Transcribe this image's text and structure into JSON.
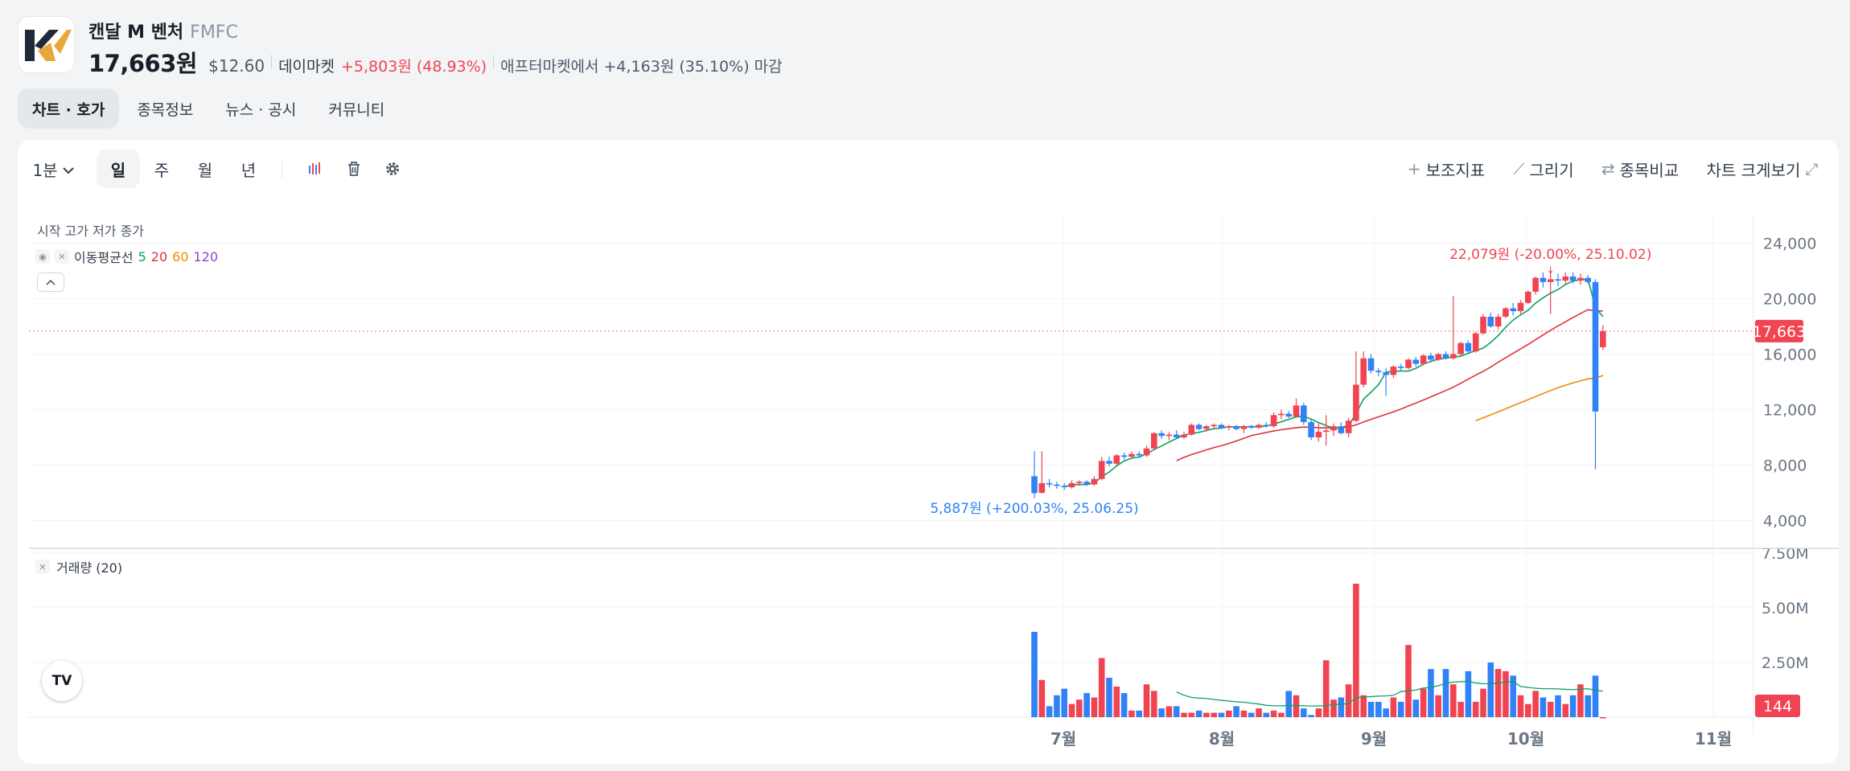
{
  "stock": {
    "name": "캔달 M 벤처",
    "ticker": "FMFC",
    "price": "17,663원",
    "usd": "$12.60",
    "market_label": "데이마켓",
    "change": "+5,803원 (48.93%)",
    "after_market": "애프터마켓에서 +4,163원 (35.10%) 마감"
  },
  "tabs": [
    {
      "label": "차트 · 호가",
      "active": true
    },
    {
      "label": "종목정보"
    },
    {
      "label": "뉴스 · 공시"
    },
    {
      "label": "커뮤니티"
    }
  ],
  "toolbar": {
    "interval": "1분",
    "periods": [
      "일",
      "주",
      "월",
      "년"
    ],
    "active_period": "일",
    "indicator_label": "보조지표",
    "draw_label": "그리기",
    "compare_label": "종목비교",
    "expand_label": "차트 크게보기",
    "icons": [
      "candle-type-icon",
      "trash-icon",
      "gear-icon"
    ]
  },
  "legend": {
    "ohlc_label": "시작 고가 저가 종가",
    "ma_label": "이동평균선",
    "ma_periods": [
      {
        "label": "5",
        "color": "#0ea163"
      },
      {
        "label": "20",
        "color": "#e0303d"
      },
      {
        "label": "60",
        "color": "#f08c00"
      },
      {
        "label": "120",
        "color": "#8e44c8"
      }
    ],
    "volume_label": "거래량 (20)"
  },
  "chart_data": {
    "type": "candlestick",
    "x_axis_labels": [
      "7월",
      "8월",
      "9월",
      "10월",
      "11월"
    ],
    "y_ticks": [
      "24,000",
      "20,000",
      "16,000",
      "12,000",
      "8,000",
      "4,000"
    ],
    "volume_ticks": [
      "7.50M",
      "5.00M",
      "2.50M"
    ],
    "current_price_label": "17,663",
    "current_volume_label": "144",
    "high_annotation": "22,079원 (-20.00%, 25.10.02)",
    "low_annotation": "5,887원 (+200.03%, 25.06.25)",
    "ylim": [
      2000,
      26000
    ],
    "volume_max": 7500000,
    "up_color": "#f04452",
    "down_color": "#3182f6",
    "candles": [
      {
        "date": "25.06.25",
        "o": 7200,
        "h": 9000,
        "l": 5887,
        "c": 6000,
        "v": 3900000
      },
      {
        "date": "25.06.26",
        "o": 6000,
        "h": 9000,
        "l": 5950,
        "c": 6700,
        "v": 1700000
      },
      {
        "date": "25.06.27",
        "o": 6700,
        "h": 7000,
        "l": 6400,
        "c": 6600,
        "v": 500000
      },
      {
        "date": "25.06.30",
        "o": 6600,
        "h": 6800,
        "l": 6300,
        "c": 6500,
        "v": 1000000
      },
      {
        "date": "25.07.01",
        "o": 6500,
        "h": 6700,
        "l": 6200,
        "c": 6400,
        "v": 1300000
      },
      {
        "date": "25.07.02",
        "o": 6400,
        "h": 6900,
        "l": 6300,
        "c": 6700,
        "v": 600000
      },
      {
        "date": "25.07.03",
        "o": 6700,
        "h": 6900,
        "l": 6500,
        "c": 6800,
        "v": 800000
      },
      {
        "date": "25.07.07",
        "o": 6800,
        "h": 6900,
        "l": 6500,
        "c": 6600,
        "v": 1100000
      },
      {
        "date": "25.07.08",
        "o": 6600,
        "h": 7200,
        "l": 6500,
        "c": 7000,
        "v": 900000
      },
      {
        "date": "25.07.09",
        "o": 7000,
        "h": 8600,
        "l": 6900,
        "c": 8300,
        "v": 2700000
      },
      {
        "date": "25.07.10",
        "o": 8300,
        "h": 8600,
        "l": 7900,
        "c": 8100,
        "v": 1800000
      },
      {
        "date": "25.07.11",
        "o": 8100,
        "h": 8800,
        "l": 7900,
        "c": 8700,
        "v": 1400000
      },
      {
        "date": "25.07.14",
        "o": 8700,
        "h": 8900,
        "l": 8400,
        "c": 8600,
        "v": 1100000
      },
      {
        "date": "25.07.15",
        "o": 8600,
        "h": 9000,
        "l": 8500,
        "c": 8800,
        "v": 300000
      },
      {
        "date": "25.07.16",
        "o": 8800,
        "h": 9000,
        "l": 8500,
        "c": 8700,
        "v": 300000
      },
      {
        "date": "25.07.17",
        "o": 8700,
        "h": 9400,
        "l": 8600,
        "c": 9200,
        "v": 1500000
      },
      {
        "date": "25.07.18",
        "o": 9200,
        "h": 10400,
        "l": 9100,
        "c": 10300,
        "v": 1200000
      },
      {
        "date": "25.07.21",
        "o": 10300,
        "h": 10500,
        "l": 9900,
        "c": 10100,
        "v": 400000
      },
      {
        "date": "25.07.22",
        "o": 10100,
        "h": 10400,
        "l": 9800,
        "c": 10200,
        "v": 500000
      },
      {
        "date": "25.07.23",
        "o": 10200,
        "h": 10500,
        "l": 9900,
        "c": 10000,
        "v": 500000
      },
      {
        "date": "25.07.24",
        "o": 10000,
        "h": 10400,
        "l": 9900,
        "c": 10200,
        "v": 200000
      },
      {
        "date": "25.07.25",
        "o": 10200,
        "h": 11000,
        "l": 10100,
        "c": 10900,
        "v": 200000
      },
      {
        "date": "25.07.28",
        "o": 10900,
        "h": 11000,
        "l": 10500,
        "c": 10600,
        "v": 300000
      },
      {
        "date": "25.07.29",
        "o": 10600,
        "h": 10900,
        "l": 10400,
        "c": 10800,
        "v": 200000
      },
      {
        "date": "25.07.30",
        "o": 10800,
        "h": 11000,
        "l": 10600,
        "c": 10900,
        "v": 200000
      },
      {
        "date": "25.07.31",
        "o": 10900,
        "h": 11000,
        "l": 10600,
        "c": 10700,
        "v": 200000
      },
      {
        "date": "25.08.01",
        "o": 10700,
        "h": 10900,
        "l": 10500,
        "c": 10800,
        "v": 300000
      },
      {
        "date": "25.08.04",
        "o": 10800,
        "h": 10900,
        "l": 10500,
        "c": 10600,
        "v": 500000
      },
      {
        "date": "25.08.05",
        "o": 10600,
        "h": 10900,
        "l": 10300,
        "c": 10800,
        "v": 300000
      },
      {
        "date": "25.08.06",
        "o": 10800,
        "h": 10900,
        "l": 10600,
        "c": 10700,
        "v": 200000
      },
      {
        "date": "25.08.07",
        "o": 10700,
        "h": 11000,
        "l": 10600,
        "c": 10900,
        "v": 400000
      },
      {
        "date": "25.08.08",
        "o": 10900,
        "h": 11100,
        "l": 10700,
        "c": 10800,
        "v": 200000
      },
      {
        "date": "25.08.11",
        "o": 10800,
        "h": 11800,
        "l": 10700,
        "c": 11600,
        "v": 300000
      },
      {
        "date": "25.08.12",
        "o": 11600,
        "h": 12000,
        "l": 11300,
        "c": 11700,
        "v": 200000
      },
      {
        "date": "25.08.13",
        "o": 11700,
        "h": 11900,
        "l": 11400,
        "c": 11500,
        "v": 1200000
      },
      {
        "date": "25.08.14",
        "o": 11500,
        "h": 12800,
        "l": 11400,
        "c": 12300,
        "v": 1000000
      },
      {
        "date": "25.08.15",
        "o": 12300,
        "h": 12500,
        "l": 10900,
        "c": 11100,
        "v": 400000
      },
      {
        "date": "25.08.18",
        "o": 11100,
        "h": 11300,
        "l": 9800,
        "c": 10000,
        "v": 100000
      },
      {
        "date": "25.08.19",
        "o": 10000,
        "h": 11000,
        "l": 9700,
        "c": 10400,
        "v": 400000
      },
      {
        "date": "25.08.20",
        "o": 10400,
        "h": 11600,
        "l": 9400,
        "c": 10500,
        "v": 2600000
      },
      {
        "date": "25.08.21",
        "o": 10500,
        "h": 11000,
        "l": 10100,
        "c": 10800,
        "v": 800000
      },
      {
        "date": "25.08.22",
        "o": 10800,
        "h": 11100,
        "l": 10200,
        "c": 10300,
        "v": 900000
      },
      {
        "date": "25.08.25",
        "o": 10300,
        "h": 11400,
        "l": 10000,
        "c": 11200,
        "v": 1500000
      },
      {
        "date": "25.08.26",
        "o": 11200,
        "h": 16200,
        "l": 11100,
        "c": 13800,
        "v": 6100000
      },
      {
        "date": "25.08.27",
        "o": 13800,
        "h": 16200,
        "l": 13600,
        "c": 15700,
        "v": 1000000
      },
      {
        "date": "25.08.28",
        "o": 15700,
        "h": 16000,
        "l": 14600,
        "c": 14800,
        "v": 700000
      },
      {
        "date": "25.08.29",
        "o": 14800,
        "h": 15000,
        "l": 14400,
        "c": 14700,
        "v": 700000
      },
      {
        "date": "25.09.02",
        "o": 14700,
        "h": 15000,
        "l": 13000,
        "c": 14500,
        "v": 400000
      },
      {
        "date": "25.09.03",
        "o": 14500,
        "h": 15200,
        "l": 14300,
        "c": 15100,
        "v": 900000
      },
      {
        "date": "25.09.04",
        "o": 15100,
        "h": 15300,
        "l": 14800,
        "c": 15000,
        "v": 700000
      },
      {
        "date": "25.09.05",
        "o": 15000,
        "h": 15700,
        "l": 14900,
        "c": 15600,
        "v": 3300000
      },
      {
        "date": "25.09.08",
        "o": 15600,
        "h": 15800,
        "l": 15100,
        "c": 15300,
        "v": 800000
      },
      {
        "date": "25.09.09",
        "o": 15300,
        "h": 16000,
        "l": 15200,
        "c": 15900,
        "v": 1300000
      },
      {
        "date": "25.09.10",
        "o": 15900,
        "h": 16100,
        "l": 15400,
        "c": 15600,
        "v": 2200000
      },
      {
        "date": "25.09.11",
        "o": 15600,
        "h": 16100,
        "l": 15500,
        "c": 16000,
        "v": 1000000
      },
      {
        "date": "25.09.12",
        "o": 16000,
        "h": 16200,
        "l": 15600,
        "c": 15700,
        "v": 2200000
      },
      {
        "date": "25.09.15",
        "o": 15700,
        "h": 20200,
        "l": 15600,
        "c": 16000,
        "v": 1500000
      },
      {
        "date": "25.09.16",
        "o": 16000,
        "h": 16900,
        "l": 15900,
        "c": 16800,
        "v": 700000
      },
      {
        "date": "25.09.17",
        "o": 16800,
        "h": 17000,
        "l": 16000,
        "c": 16200,
        "v": 2100000
      },
      {
        "date": "25.09.18",
        "o": 16200,
        "h": 17600,
        "l": 16100,
        "c": 17500,
        "v": 700000
      },
      {
        "date": "25.09.19",
        "o": 17500,
        "h": 18900,
        "l": 17400,
        "c": 18700,
        "v": 1300000
      },
      {
        "date": "25.09.22",
        "o": 18700,
        "h": 19000,
        "l": 17900,
        "c": 18000,
        "v": 2500000
      },
      {
        "date": "25.09.23",
        "o": 18000,
        "h": 18900,
        "l": 17800,
        "c": 18700,
        "v": 2200000
      },
      {
        "date": "25.09.24",
        "o": 18700,
        "h": 19400,
        "l": 18600,
        "c": 19300,
        "v": 2100000
      },
      {
        "date": "25.09.25",
        "o": 19300,
        "h": 19700,
        "l": 18800,
        "c": 19100,
        "v": 1900000
      },
      {
        "date": "25.09.26",
        "o": 19100,
        "h": 19900,
        "l": 18900,
        "c": 19700,
        "v": 1000000
      },
      {
        "date": "25.09.29",
        "o": 19700,
        "h": 20600,
        "l": 19600,
        "c": 20500,
        "v": 600000
      },
      {
        "date": "25.09.30",
        "o": 20500,
        "h": 21600,
        "l": 20300,
        "c": 21500,
        "v": 1200000
      },
      {
        "date": "25.10.01",
        "o": 21500,
        "h": 21900,
        "l": 20800,
        "c": 21200,
        "v": 900000
      },
      {
        "date": "25.10.02",
        "o": 21200,
        "h": 22079,
        "l": 18900,
        "c": 21400,
        "v": 700000
      },
      {
        "date": "25.10.03",
        "o": 21400,
        "h": 21800,
        "l": 20900,
        "c": 21300,
        "v": 1000000
      },
      {
        "date": "25.10.06",
        "o": 21300,
        "h": 21900,
        "l": 21000,
        "c": 21600,
        "v": 600000
      },
      {
        "date": "25.10.07",
        "o": 21600,
        "h": 21900,
        "l": 21100,
        "c": 21300,
        "v": 1000000
      },
      {
        "date": "25.10.08",
        "o": 21300,
        "h": 21800,
        "l": 21000,
        "c": 21500,
        "v": 1500000
      },
      {
        "date": "25.10.09",
        "o": 21500,
        "h": 21700,
        "l": 21100,
        "c": 21200,
        "v": 1000000
      },
      {
        "date": "25.10.10",
        "o": 21200,
        "h": 21400,
        "l": 7700,
        "c": 11860,
        "v": 1900000
      },
      {
        "date": "25.10.13",
        "o": 16500,
        "h": 18100,
        "l": 16300,
        "c": 17663,
        "v": 144
      }
    ],
    "ma5": [
      null,
      null,
      null,
      null,
      6440,
      6580,
      6600,
      6600,
      6700,
      7160,
      7500,
      7940,
      8300,
      8500,
      8580,
      8800,
      9120,
      9380,
      9660,
      9920,
      10160,
      10280,
      10360,
      10500,
      10620,
      10680,
      10760,
      10760,
      10760,
      10780,
      10760,
      10820,
      10960,
      11120,
      11300,
      11480,
      11520,
      11320,
      11060,
      10860,
      10640,
      10720,
      10840,
      11720,
      12760,
      13260,
      13800,
      14700,
      14780,
      14780,
      14780,
      14980,
      15280,
      15480,
      15640,
      15720,
      15780,
      15860,
      16060,
      16260,
      16440,
      16840,
      17340,
      17940,
      18460,
      18840,
      19160,
      19680,
      20060,
      20400,
      20660,
      21020,
      21280,
      21360,
      21400,
      19372,
      18700
    ],
    "ma20": [
      null,
      null,
      null,
      null,
      null,
      null,
      null,
      null,
      null,
      null,
      null,
      null,
      null,
      null,
      null,
      null,
      null,
      null,
      null,
      8320,
      8560,
      8760,
      8930,
      9100,
      9260,
      9400,
      9560,
      9740,
      9930,
      10130,
      10240,
      10350,
      10460,
      10550,
      10620,
      10700,
      10740,
      10730,
      10700,
      10680,
      10680,
      10700,
      10750,
      10900,
      11110,
      11300,
      11480,
      11660,
      11840,
      12040,
      12260,
      12470,
      12690,
      12920,
      13150,
      13380,
      13620,
      13900,
      14200,
      14490,
      14760,
      15070,
      15420,
      15740,
      16060,
      16380,
      16700,
      17040,
      17380,
      17720,
      18030,
      18340,
      18640,
      18930,
      19200,
      19130,
      19110
    ],
    "ma60": [
      null,
      null,
      null,
      null,
      null,
      null,
      null,
      null,
      null,
      null,
      null,
      null,
      null,
      null,
      null,
      null,
      null,
      null,
      null,
      null,
      null,
      null,
      null,
      null,
      null,
      null,
      null,
      null,
      null,
      null,
      null,
      null,
      null,
      null,
      null,
      null,
      null,
      null,
      null,
      null,
      null,
      null,
      null,
      null,
      null,
      null,
      null,
      null,
      null,
      null,
      null,
      null,
      null,
      null,
      null,
      null,
      null,
      null,
      null,
      11200,
      11410,
      11620,
      11840,
      12060,
      12280,
      12500,
      12720,
      12940,
      13160,
      13380,
      13580,
      13760,
      13930,
      14080,
      14220,
      14280,
      14460
    ],
    "vol_ma20": [
      null,
      null,
      null,
      null,
      null,
      null,
      null,
      null,
      null,
      null,
      null,
      null,
      null,
      null,
      null,
      null,
      null,
      null,
      null,
      1150000,
      1000000,
      900000,
      870000,
      850000,
      810000,
      770000,
      740000,
      700000,
      680000,
      640000,
      600000,
      540000,
      520000,
      520000,
      530000,
      530000,
      520000,
      510000,
      510000,
      530000,
      580000,
      590000,
      620000,
      890000,
      920000,
      940000,
      960000,
      970000,
      1000000,
      1170000,
      1200000,
      1240000,
      1330000,
      1360000,
      1440000,
      1550000,
      1600000,
      1620000,
      1640000,
      1560000,
      1530000,
      1520000,
      1560000,
      1600000,
      1630000,
      1400000,
      1360000,
      1320000,
      1300000,
      1300000,
      1290000,
      1270000,
      1260000,
      1280000,
      1300000,
      1230000,
      1190000
    ]
  }
}
